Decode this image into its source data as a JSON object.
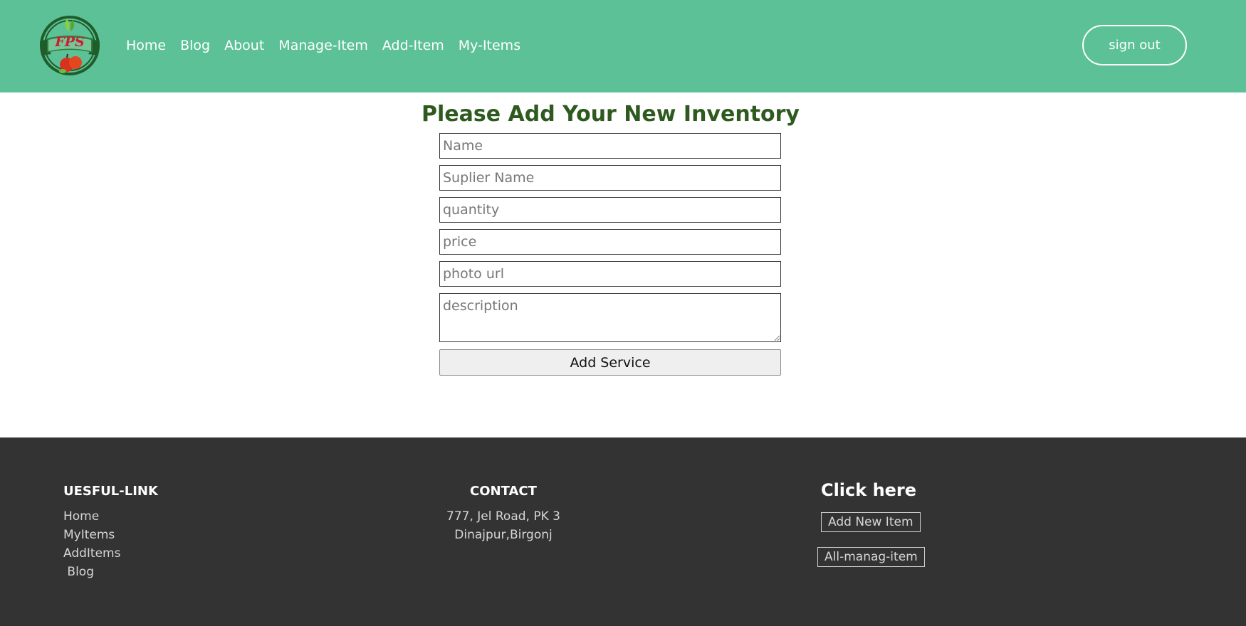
{
  "header": {
    "logo_text": "FPS",
    "nav": [
      "Home",
      "Blog",
      "About",
      "Manage-Item",
      "Add-Item",
      "My-Items"
    ],
    "signout_label": "sign out",
    "bg_color": "#5dc198"
  },
  "main": {
    "title": "Please Add Your New Inventory",
    "fields": {
      "name_placeholder": "Name",
      "supplier_placeholder": "Suplier Name",
      "quantity_placeholder": "quantity",
      "price_placeholder": "price",
      "photo_placeholder": "photo url",
      "description_placeholder": "description"
    },
    "submit_label": "Add Service"
  },
  "footer": {
    "useful_title": "UESFUL-LINK",
    "useful_links": [
      "Home",
      "MyItems",
      "AddItems",
      " Blog"
    ],
    "contact_title": "CONTACT",
    "contact_lines": [
      "777, Jel Road, PK 3",
      "Dinajpur,Birgonj"
    ],
    "click_title": "Click here",
    "add_new_item_label": "Add New Item",
    "all_manage_label": "All-manag-item",
    "bg_color": "#333333"
  }
}
